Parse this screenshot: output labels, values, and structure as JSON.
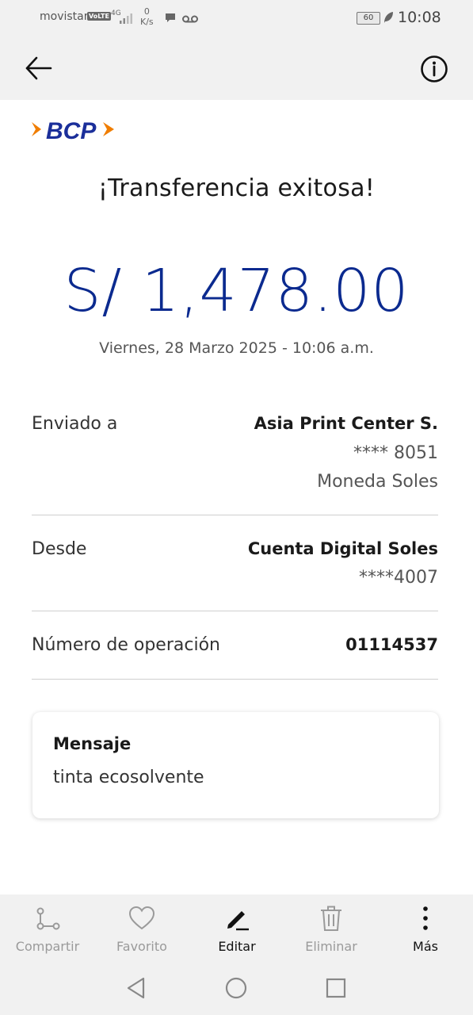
{
  "status_bar": {
    "carrier": "movistar",
    "volte": "VoLTE",
    "network": "4G",
    "speed_value": "0",
    "speed_unit": "K/s",
    "battery": "60",
    "time": "10:08"
  },
  "app_bar": {
    "back_icon": "arrow-left-icon",
    "info_icon": "info-circle-icon"
  },
  "receipt": {
    "bank_logo": "BCP",
    "title": "¡Transferencia exitosa!",
    "amount": "S/ 1,478.00",
    "datetime": "Viernes, 28 Marzo 2025 - 10:06 a.m.",
    "sent_to": {
      "label": "Enviado a",
      "name": "Asia Print Center S.",
      "account": "**** 8051",
      "currency": "Moneda Soles"
    },
    "from": {
      "label": "Desde",
      "account_name": "Cuenta Digital Soles",
      "account_number": "****4007"
    },
    "operation": {
      "label": "Número de operación",
      "number": "01114537"
    },
    "message": {
      "title": "Mensaje",
      "text": "tinta ecosolvente"
    }
  },
  "toolbar": {
    "items": [
      {
        "label": "Compartir",
        "icon": "share-icon",
        "enabled": false
      },
      {
        "label": "Favorito",
        "icon": "heart-icon",
        "enabled": false
      },
      {
        "label": "Editar",
        "icon": "pencil-icon",
        "enabled": true
      },
      {
        "label": "Eliminar",
        "icon": "trash-icon",
        "enabled": false
      },
      {
        "label": "Más",
        "icon": "more-vertical-icon",
        "enabled": true
      }
    ]
  },
  "colors": {
    "amount": "#0b2a8f",
    "logo_blue": "#1b2f9a",
    "logo_orange": "#f07d00",
    "bars_bg": "#f1f1f1"
  }
}
